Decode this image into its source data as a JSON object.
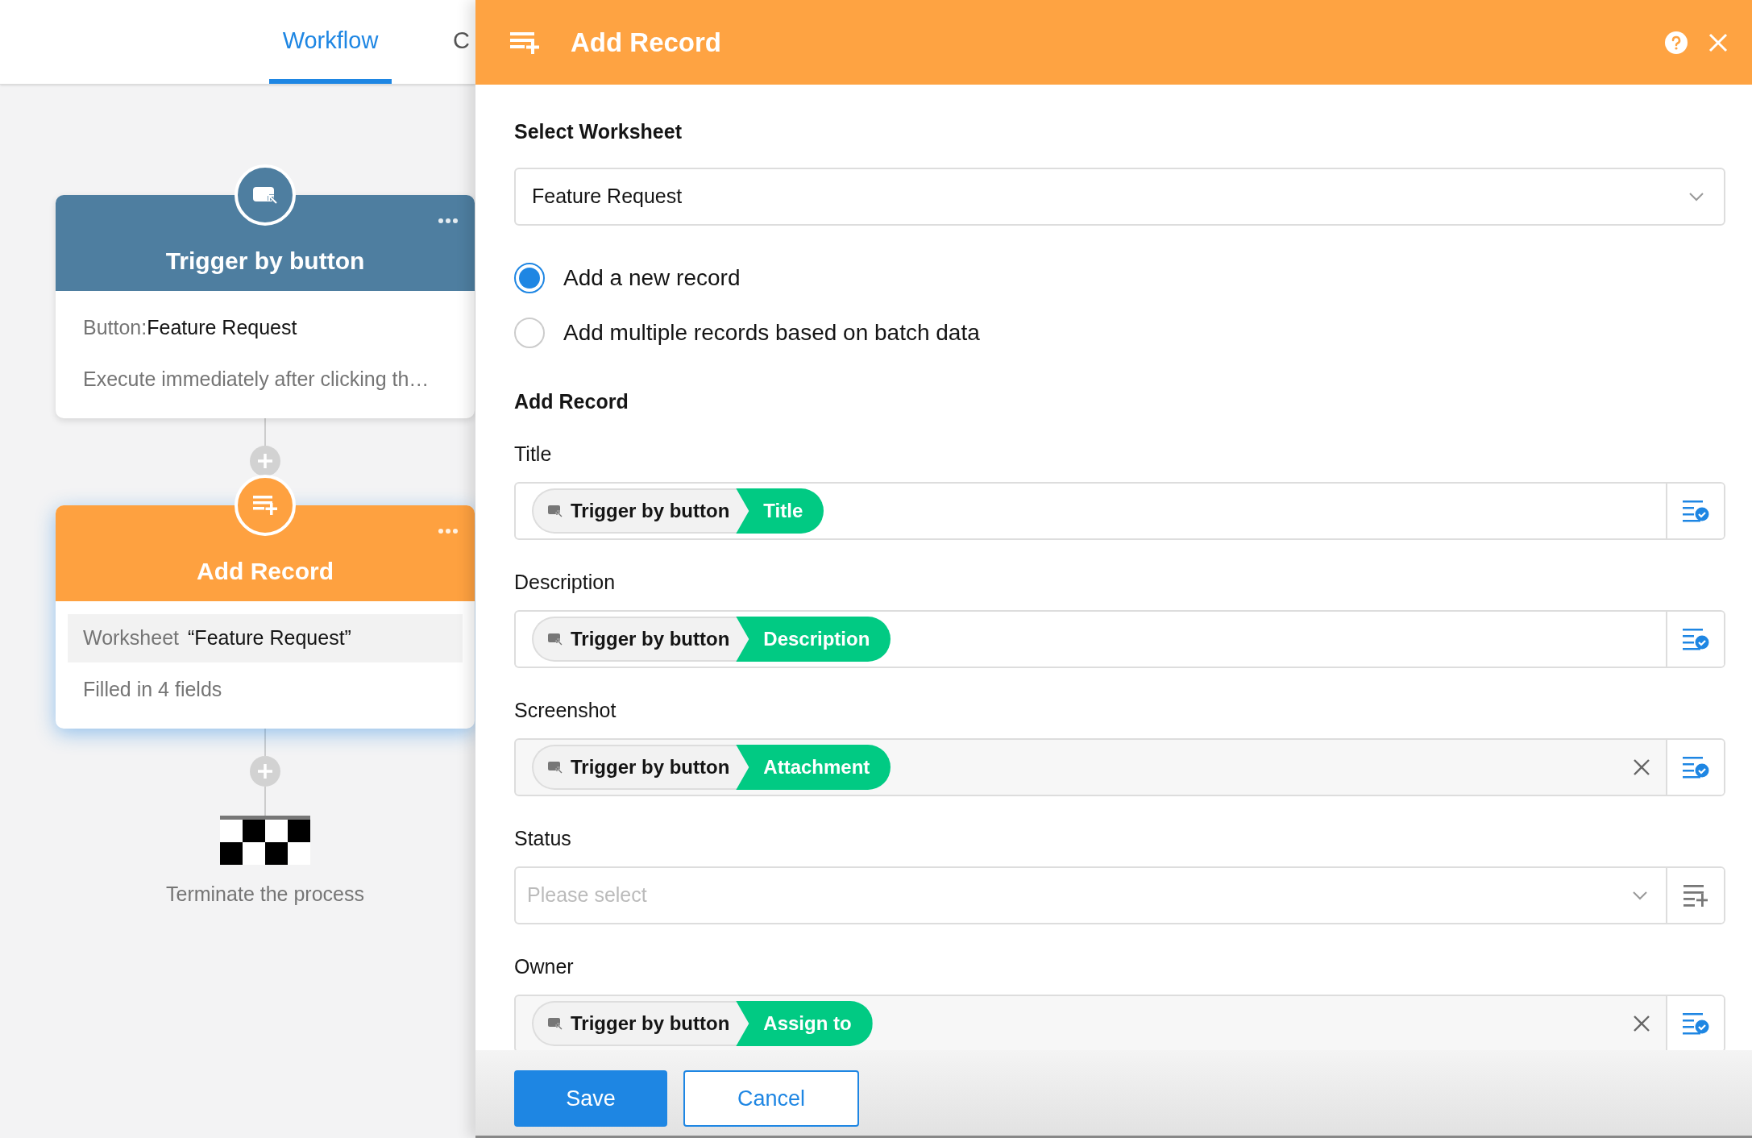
{
  "tabs": [
    {
      "label": "Workflow",
      "selected": true
    },
    {
      "label": "C",
      "selected": false
    }
  ],
  "nodes": [
    {
      "kind": "trigger",
      "title": "Trigger by button",
      "selected": false,
      "lines": [
        {
          "label": "Button:",
          "value": "Feature Request",
          "highlighted": false
        },
        {
          "label": "Execute immediately after clicking th…",
          "highlighted": false
        }
      ]
    },
    {
      "kind": "add_record",
      "title": "Add Record",
      "selected": true,
      "lines": [
        {
          "label": "Worksheet",
          "value": "“Feature Request”",
          "highlighted": true
        },
        {
          "label": "Filled in 4 fields",
          "highlighted": false
        }
      ]
    }
  ],
  "end_node": {
    "label": "Terminate the process"
  },
  "drawer": {
    "title": "Add Record",
    "worksheet_section": {
      "heading": "Select Worksheet",
      "value": "Feature Request"
    },
    "modes": [
      {
        "label": "Add a new record",
        "selected": true
      },
      {
        "label": "Add multiple records based on batch data",
        "selected": false
      }
    ],
    "record_section": {
      "heading": "Add Record"
    },
    "fields": [
      {
        "label": "Title",
        "kind": "token",
        "clearable": false,
        "token": {
          "source": "Trigger by button",
          "field": "Title"
        }
      },
      {
        "label": "Description",
        "kind": "token",
        "clearable": false,
        "token": {
          "source": "Trigger by button",
          "field": "Description"
        }
      },
      {
        "label": "Screenshot",
        "kind": "token",
        "clearable": true,
        "token": {
          "source": "Trigger by button",
          "field": "Attachment"
        }
      },
      {
        "label": "Status",
        "kind": "select",
        "placeholder": "Please select"
      },
      {
        "label": "Owner",
        "kind": "token",
        "clearable": true,
        "token": {
          "source": "Trigger by button",
          "field": "Assign to"
        }
      }
    ],
    "buttons": [
      {
        "label": "Save",
        "kind": "primary"
      },
      {
        "label": "Cancel",
        "kind": "secondary"
      }
    ]
  }
}
